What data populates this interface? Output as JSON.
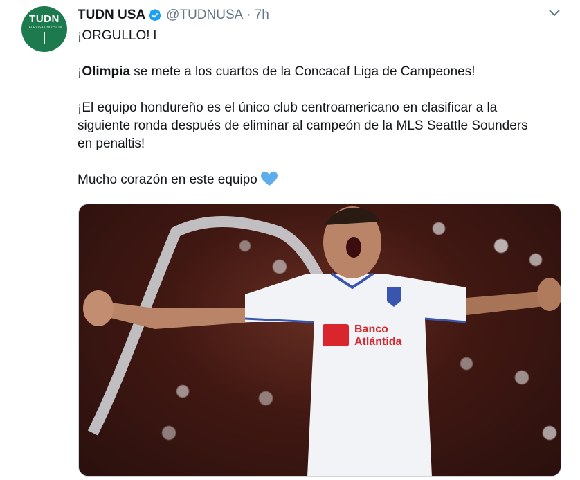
{
  "tweet": {
    "avatar": {
      "logo_text": "TUDN",
      "logo_sub": "TELEVISA UNIVISION"
    },
    "author_name": "TUDN USA",
    "handle": "@TUDNUSA",
    "separator": "·",
    "time": "7h",
    "lines": {
      "line1": "¡ORGULLO! l",
      "line2_prefix": "¡",
      "line2_bold": "Olimpia",
      "line2_rest": " se mete a los cuartos de la Concacaf Liga de Campeones!",
      "line3": "¡El equipo hondureño es el único club centroamericano en clasificar a la",
      "line4": "siguiente ronda después de eliminar al campeón de la MLS Seattle Sounders",
      "line5": "en penaltis!",
      "line6": "Mucho corazón en este equipo"
    },
    "media": {
      "sponsor_line1": "Banco",
      "sponsor_line2": "Atlántida"
    }
  },
  "colors": {
    "verified": "#1da1f2",
    "heart": "#5dadec",
    "secondary_text": "#657786",
    "brand_green": "#1d7a4f"
  },
  "icons": [
    "verified-badge-icon",
    "chevron-down-icon",
    "blue-heart-icon"
  ]
}
